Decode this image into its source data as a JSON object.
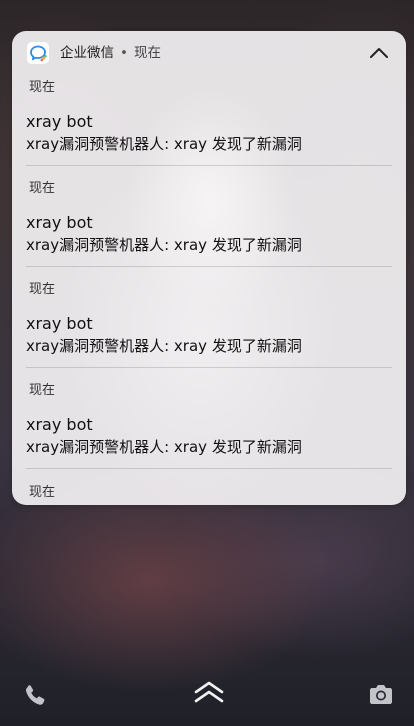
{
  "header": {
    "app_name": "企业微信",
    "separator": "•",
    "time": "现在",
    "app_icon": "wecom-chat-icon",
    "collapse_icon": "chevron-up-icon"
  },
  "notifications": [
    {
      "time": "现在",
      "title": "xray bot",
      "body": "xray漏洞预警机器人: xray 发现了新漏洞"
    },
    {
      "time": "现在",
      "title": "xray bot",
      "body": "xray漏洞预警机器人: xray 发现了新漏洞"
    },
    {
      "time": "现在",
      "title": "xray bot",
      "body": "xray漏洞预警机器人: xray 发现了新漏洞"
    },
    {
      "time": "现在",
      "title": "xray bot",
      "body": "xray漏洞预警机器人: xray 发现了新漏洞"
    },
    {
      "time": "现在"
    }
  ],
  "bottom_bar": {
    "left_icon": "phone-icon",
    "center_icon": "double-chevron-up-icon",
    "right_icon": "camera-icon"
  }
}
